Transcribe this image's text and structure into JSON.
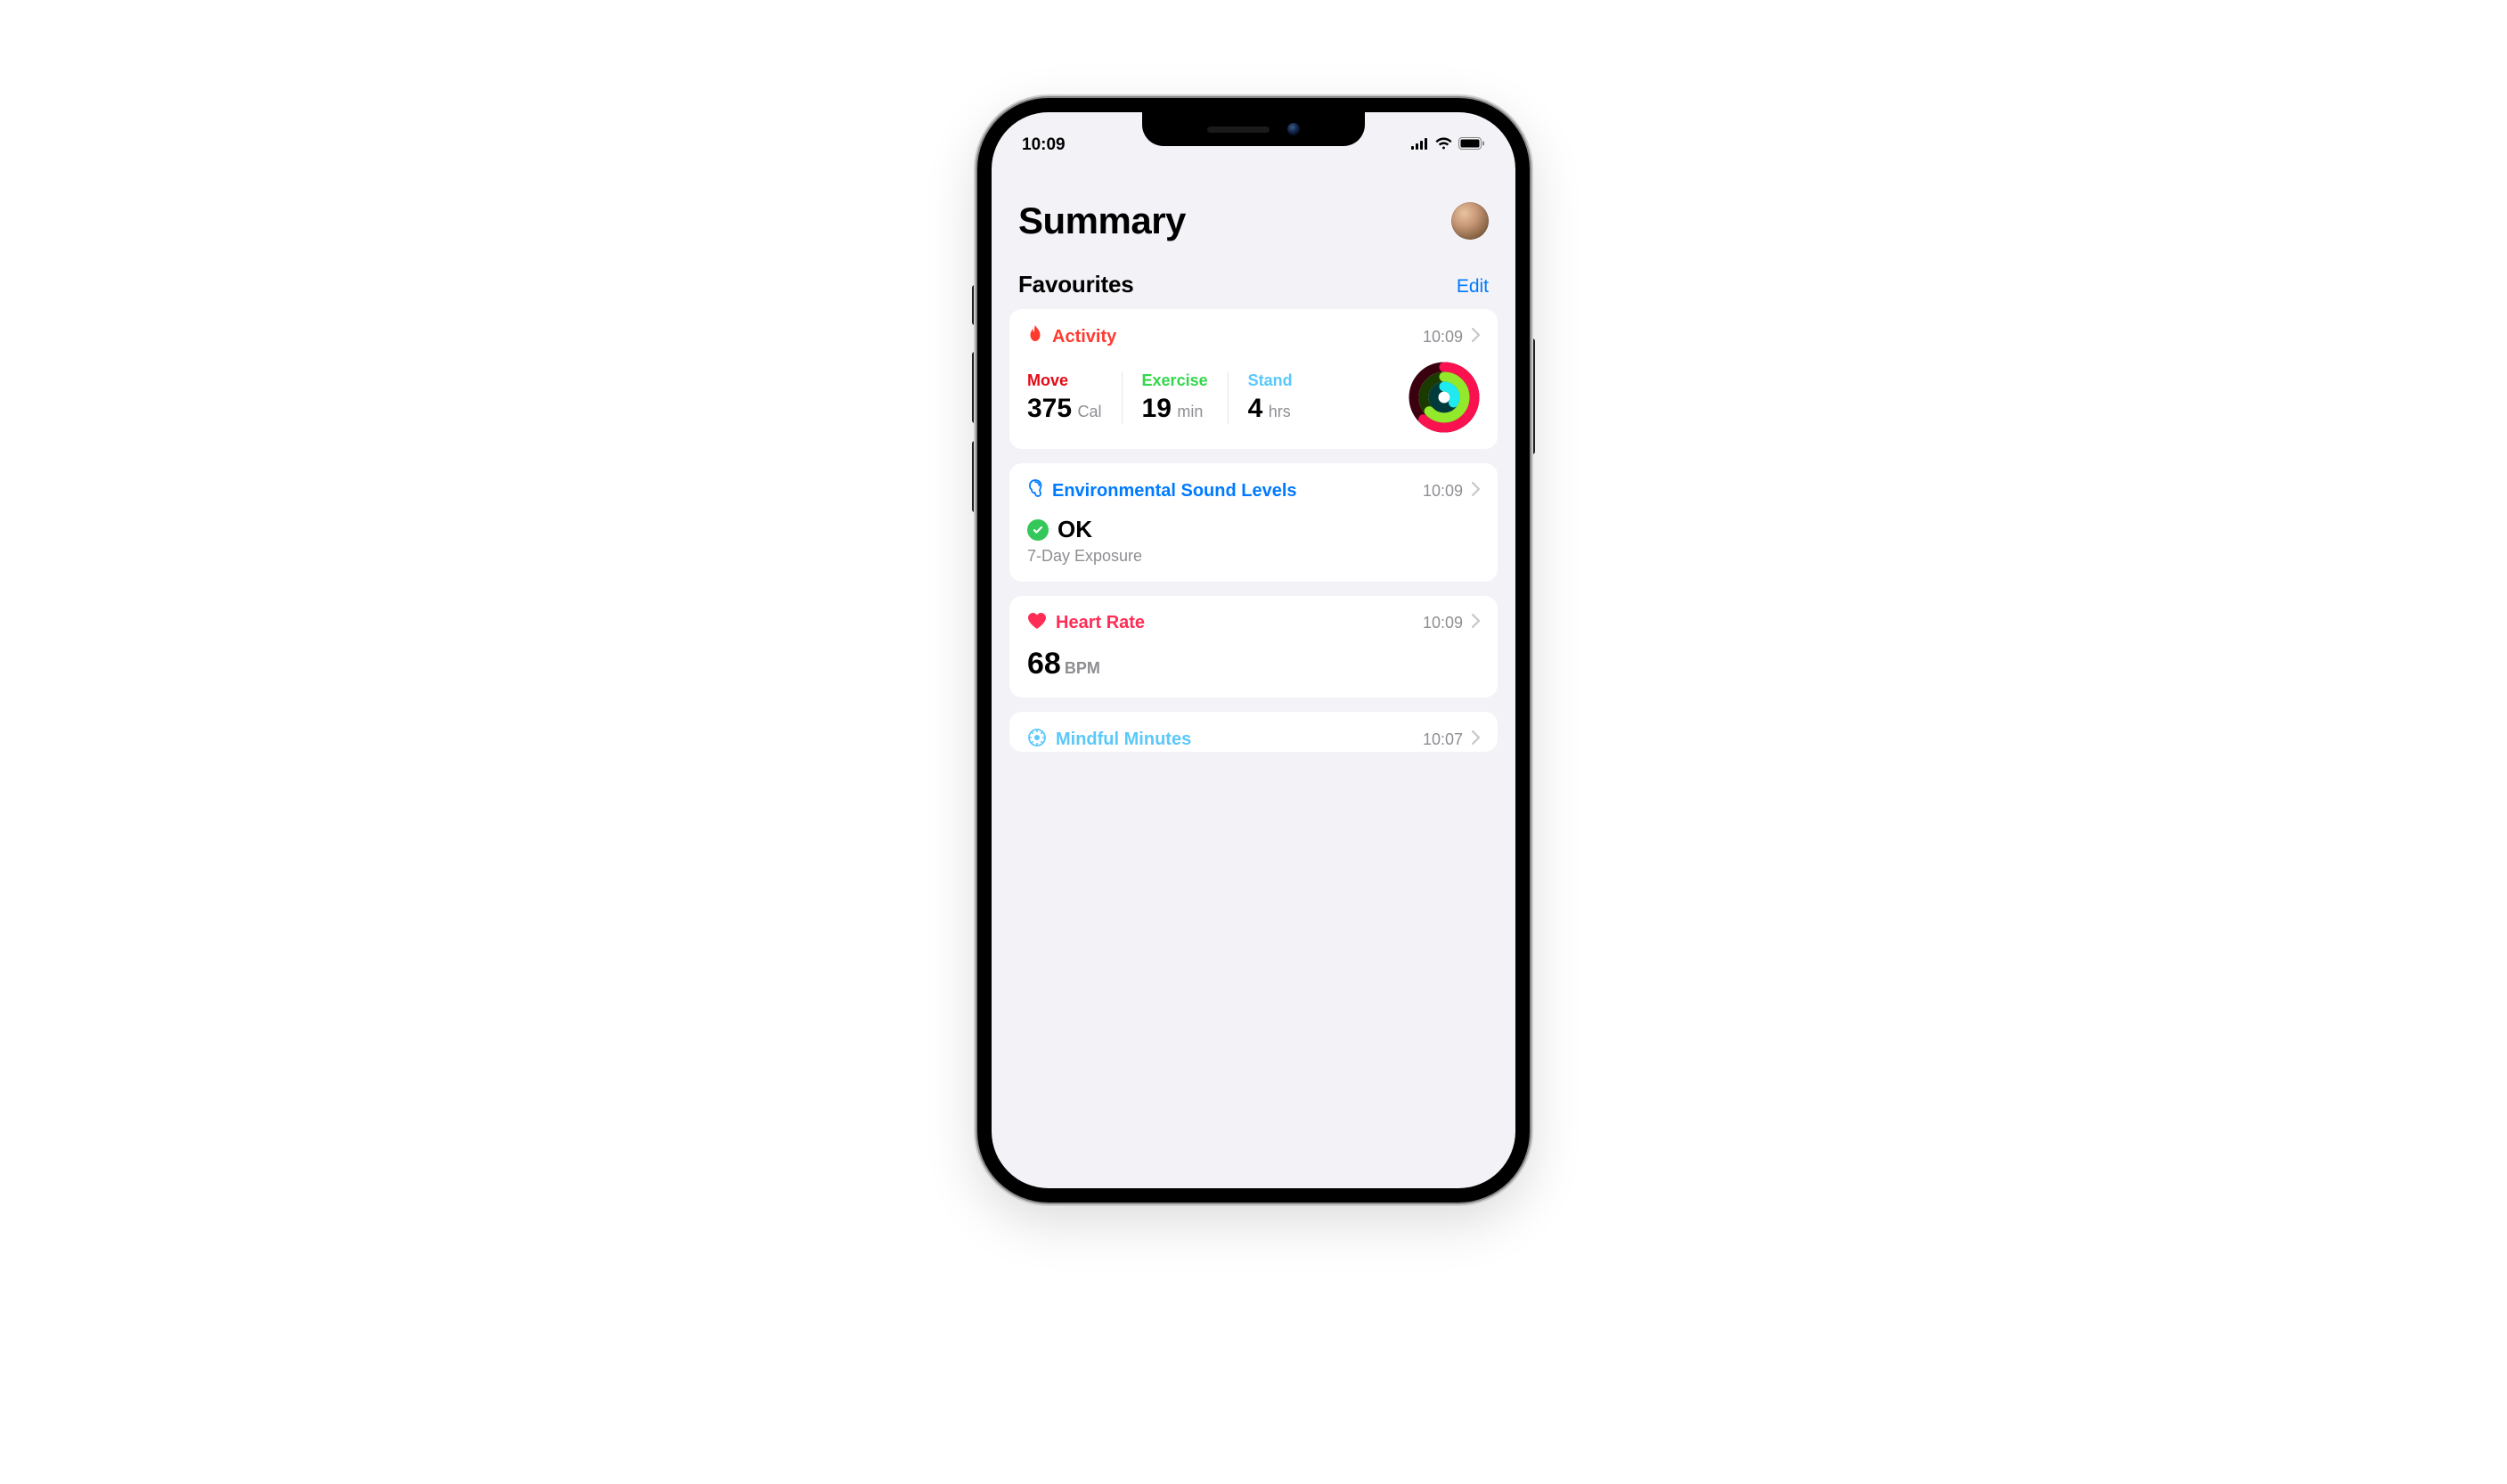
{
  "status": {
    "time": "10:09"
  },
  "page": {
    "title": "Summary"
  },
  "favourites": {
    "title": "Favourites",
    "edit": "Edit"
  },
  "cards": {
    "activity": {
      "title": "Activity",
      "time": "10:09",
      "move": {
        "label": "Move",
        "value": "375",
        "unit": "Cal"
      },
      "exercise": {
        "label": "Exercise",
        "value": "19",
        "unit": "min"
      },
      "stand": {
        "label": "Stand",
        "value": "4",
        "unit": "hrs"
      },
      "rings": {
        "move_frac": 0.62,
        "exercise_frac": 0.63,
        "stand_frac": 0.33
      }
    },
    "hearing": {
      "title": "Environmental Sound Levels",
      "time": "10:09",
      "status": "OK",
      "subtitle": "7-Day Exposure"
    },
    "heart": {
      "title": "Heart Rate",
      "time": "10:09",
      "value": "68",
      "unit": "BPM"
    },
    "mindful": {
      "title": "Mindful Minutes",
      "time": "10:07"
    }
  },
  "colors": {
    "move": "#fa114f",
    "exercise": "#92e82a",
    "stand": "#1eeaef",
    "link": "#007aff",
    "heart": "#ff2d55",
    "activity": "#ff3b30"
  }
}
